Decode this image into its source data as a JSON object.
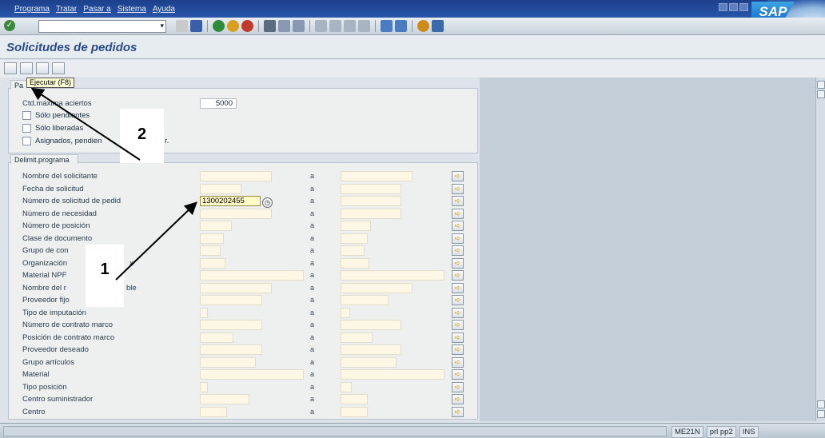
{
  "menu": [
    "Programa",
    "Tratar",
    "Pasar a",
    "Sistema",
    "Ayuda"
  ],
  "logo_text": "SAP",
  "window_title": "Solicitudes de pedidos",
  "tooltip": "Ejecutar   (F8)",
  "groups": {
    "params_tab": "Pa",
    "delimit_tab": "Delimit.programa"
  },
  "params": {
    "max_label": "Ctd.máxima aciertos",
    "max_value": "5000",
    "checkboxes": [
      "Sólo pendientes",
      "Sólo liberadas",
      "Asignados, pendien",
      "r."
    ]
  },
  "criteria": [
    "Nombre del solicitante",
    "Fecha de solicitud",
    "Número de solicitud de pedid",
    "Número de necesidad",
    "Número de posición",
    "Clase de documento",
    "Grupo de con",
    "Organización",
    "Material NPF",
    "Nombre del r",
    "Proveedor fijo",
    "Tipo de imputación",
    "Número de contrato marco",
    "Posición de contrato marco",
    "Proveedor deseado",
    "Grupo artículos",
    "Material",
    "Tipo posición",
    "Centro suministrador",
    "Centro"
  ],
  "criteria_extra": {
    "org_suffix": "x",
    "nombre_suffix": "ble"
  },
  "range_label": "a",
  "solicitud_value": "1300202455",
  "annotations": [
    "1",
    "2"
  ],
  "status": {
    "transaction": "ME21N",
    "server": "prl pp2",
    "mode": "INS"
  }
}
